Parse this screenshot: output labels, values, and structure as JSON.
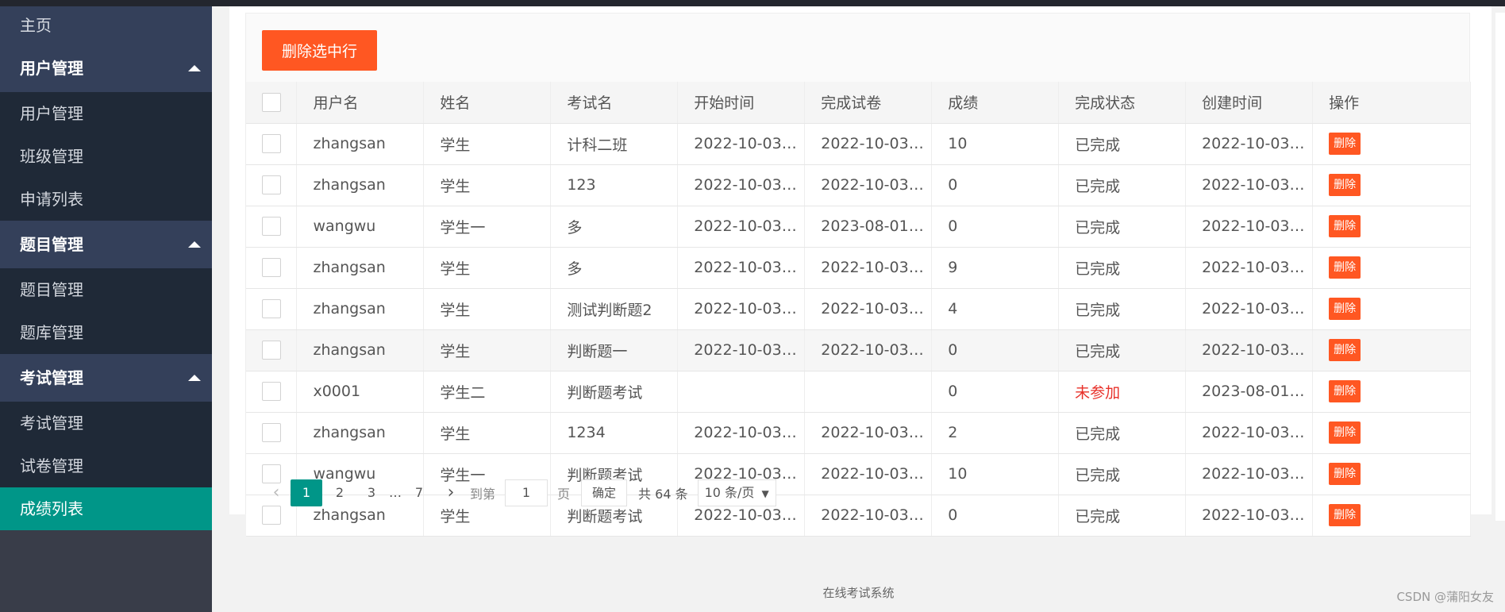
{
  "sidebar": {
    "home": "主页",
    "groups": [
      {
        "title": "用户管理",
        "items": [
          "用户管理",
          "班级管理",
          "申请列表"
        ]
      },
      {
        "title": "题目管理",
        "items": [
          "题目管理",
          "题库管理"
        ]
      },
      {
        "title": "考试管理",
        "items": [
          "考试管理",
          "试卷管理",
          "成绩列表"
        ]
      }
    ],
    "active_item": "成绩列表"
  },
  "toolbar": {
    "delete_selected": "删除选中行"
  },
  "table": {
    "columns": [
      "用户名",
      "姓名",
      "考试名",
      "开始时间",
      "完成试卷",
      "成绩",
      "完成状态",
      "创建时间",
      "操作"
    ],
    "rows": [
      {
        "username": "zhangsan",
        "name": "学生",
        "exam": "计科二班",
        "start": "2022-10-03…",
        "finish": "2022-10-03…",
        "score": "10",
        "status": "已完成",
        "created": "2022-10-03…",
        "action": "删除"
      },
      {
        "username": "zhangsan",
        "name": "学生",
        "exam": "123",
        "start": "2022-10-03…",
        "finish": "2022-10-03…",
        "score": "0",
        "status": "已完成",
        "created": "2022-10-03…",
        "action": "删除"
      },
      {
        "username": "wangwu",
        "name": "学生一",
        "exam": "多",
        "start": "2022-10-03…",
        "finish": "2023-08-01…",
        "score": "0",
        "status": "已完成",
        "created": "2022-10-03…",
        "action": "删除"
      },
      {
        "username": "zhangsan",
        "name": "学生",
        "exam": "多",
        "start": "2022-10-03…",
        "finish": "2022-10-03…",
        "score": "9",
        "status": "已完成",
        "created": "2022-10-03…",
        "action": "删除"
      },
      {
        "username": "zhangsan",
        "name": "学生",
        "exam": "测试判断题2",
        "start": "2022-10-03…",
        "finish": "2022-10-03…",
        "score": "4",
        "status": "已完成",
        "created": "2022-10-03…",
        "action": "删除"
      },
      {
        "username": "zhangsan",
        "name": "学生",
        "exam": "判断题一",
        "start": "2022-10-03…",
        "finish": "2022-10-03…",
        "score": "0",
        "status": "已完成",
        "created": "2022-10-03…",
        "action": "删除"
      },
      {
        "username": "x0001",
        "name": "学生二",
        "exam": "判断题考试",
        "start": "",
        "finish": "",
        "score": "0",
        "status": "未参加",
        "created": "2023-08-01…",
        "action": "删除"
      },
      {
        "username": "zhangsan",
        "name": "学生",
        "exam": "1234",
        "start": "2022-10-03…",
        "finish": "2022-10-03…",
        "score": "2",
        "status": "已完成",
        "created": "2022-10-03…",
        "action": "删除"
      },
      {
        "username": "wangwu",
        "name": "学生一",
        "exam": "判断题考试",
        "start": "2022-10-03…",
        "finish": "2022-10-03…",
        "score": "10",
        "status": "已完成",
        "created": "2022-10-03…",
        "action": "删除"
      },
      {
        "username": "zhangsan",
        "name": "学生",
        "exam": "判断题考试",
        "start": "2022-10-03…",
        "finish": "2022-10-03…",
        "score": "0",
        "status": "已完成",
        "created": "2022-10-03…",
        "action": "删除"
      }
    ]
  },
  "pager": {
    "pages": [
      "1",
      "2",
      "3"
    ],
    "ellipsis": "…",
    "last_page": "7",
    "current": "1",
    "goto_label": "到第",
    "goto_value": "1",
    "page_unit": "页",
    "confirm": "确定",
    "total": "共 64 条",
    "page_size": "10 条/页"
  },
  "footer": {
    "text": "在线考试系统"
  },
  "watermark": "CSDN @蒲阳女友",
  "colors": {
    "accent": "#009688",
    "danger": "#ff5722",
    "sidebar_bg": "#393d49",
    "status_not_joined": "#e8312a"
  }
}
